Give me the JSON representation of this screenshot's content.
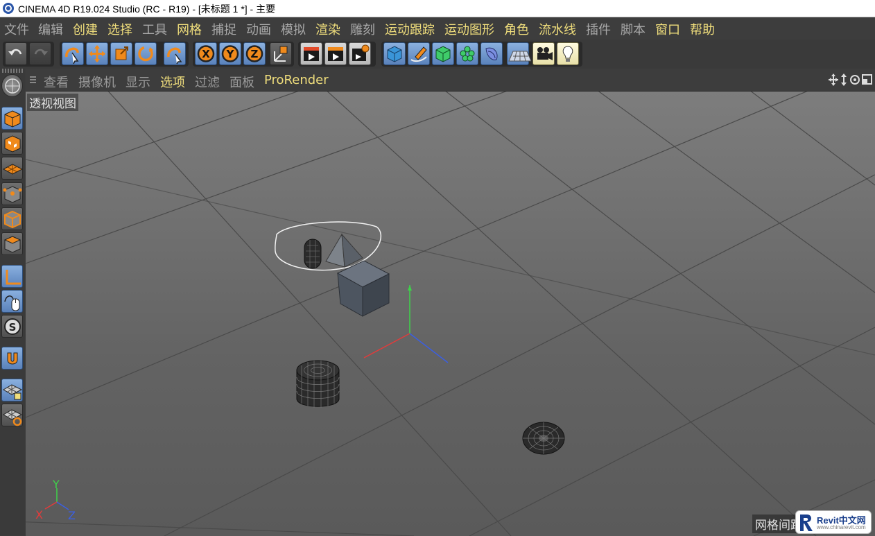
{
  "window": {
    "title": "CINEMA 4D R19.024 Studio (RC - R19) - [未标题 1 *] - 主要",
    "app_icon": "cinema4d-logo-icon"
  },
  "menubar": {
    "items": [
      {
        "label": "文件",
        "highlight": false
      },
      {
        "label": "编辑",
        "highlight": false
      },
      {
        "label": "创建",
        "highlight": true
      },
      {
        "label": "选择",
        "highlight": true
      },
      {
        "label": "工具",
        "highlight": false
      },
      {
        "label": "网格",
        "highlight": true
      },
      {
        "label": "捕捉",
        "highlight": false
      },
      {
        "label": "动画",
        "highlight": false
      },
      {
        "label": "模拟",
        "highlight": false
      },
      {
        "label": "渲染",
        "highlight": true
      },
      {
        "label": "雕刻",
        "highlight": false
      },
      {
        "label": "运动跟踪",
        "highlight": true
      },
      {
        "label": "运动图形",
        "highlight": true
      },
      {
        "label": "角色",
        "highlight": true
      },
      {
        "label": "流水线",
        "highlight": true
      },
      {
        "label": "插件",
        "highlight": false
      },
      {
        "label": "脚本",
        "highlight": false
      },
      {
        "label": "窗口",
        "highlight": true
      },
      {
        "label": "帮助",
        "highlight": true
      }
    ]
  },
  "toolbar": {
    "buttons": [
      {
        "name": "undo-icon"
      },
      {
        "name": "redo-icon"
      },
      {
        "name": "live-selection-icon"
      },
      {
        "name": "move-icon"
      },
      {
        "name": "scale-icon"
      },
      {
        "name": "rotate-icon"
      },
      {
        "name": "recent-tools-icon"
      },
      {
        "name": "x-axis-lock-icon",
        "label": "X"
      },
      {
        "name": "y-axis-lock-icon",
        "label": "Y"
      },
      {
        "name": "z-axis-lock-icon",
        "label": "Z"
      },
      {
        "name": "coordinate-system-icon"
      },
      {
        "name": "render-view-icon"
      },
      {
        "name": "render-to-picture-viewer-icon"
      },
      {
        "name": "edit-render-settings-icon"
      },
      {
        "name": "cube-primitive-icon"
      },
      {
        "name": "spline-pen-icon"
      },
      {
        "name": "subdivision-surface-icon"
      },
      {
        "name": "cloner-icon"
      },
      {
        "name": "deformer-icon"
      },
      {
        "name": "floor-icon"
      },
      {
        "name": "camera-icon"
      },
      {
        "name": "light-icon"
      }
    ]
  },
  "sidebar": {
    "buttons": [
      {
        "name": "make-editable-icon"
      },
      {
        "name": "model-mode-icon"
      },
      {
        "name": "texture-mode-icon"
      },
      {
        "name": "workplane-mode-icon"
      },
      {
        "name": "points-mode-icon"
      },
      {
        "name": "edges-mode-icon"
      },
      {
        "name": "polygons-mode-icon"
      },
      {
        "name": "axis-mode-icon"
      },
      {
        "name": "tweak-mode-icon"
      },
      {
        "name": "solo-mode-icon"
      },
      {
        "name": "snapping-icon"
      },
      {
        "name": "workplane-lock-icon"
      },
      {
        "name": "workplane-align-icon"
      }
    ]
  },
  "viewport_menu": {
    "items": [
      {
        "label": "查看",
        "highlight": false
      },
      {
        "label": "摄像机",
        "highlight": false
      },
      {
        "label": "显示",
        "highlight": false
      },
      {
        "label": "选项",
        "highlight": true
      },
      {
        "label": "过滤",
        "highlight": false
      },
      {
        "label": "面板",
        "highlight": false
      },
      {
        "label": "ProRender",
        "highlight": true
      }
    ],
    "nav_icons": [
      "pan-icon",
      "zoom-icon",
      "orbit-icon",
      "toggle-view-icon"
    ]
  },
  "viewport": {
    "label": "透视视图",
    "grid_spacing_label": "网格间距",
    "axis_labels": {
      "x": "X",
      "y": "Y",
      "z": "Z"
    },
    "objects": [
      "capsule",
      "pyramid",
      "cube",
      "cylinder",
      "disc"
    ],
    "colors": {
      "x": "#e23b3b",
      "y": "#3fd24a",
      "z": "#3b5fe2"
    }
  },
  "watermark": {
    "brand": "Revit中文网",
    "url": "www.chinarevit.com"
  }
}
